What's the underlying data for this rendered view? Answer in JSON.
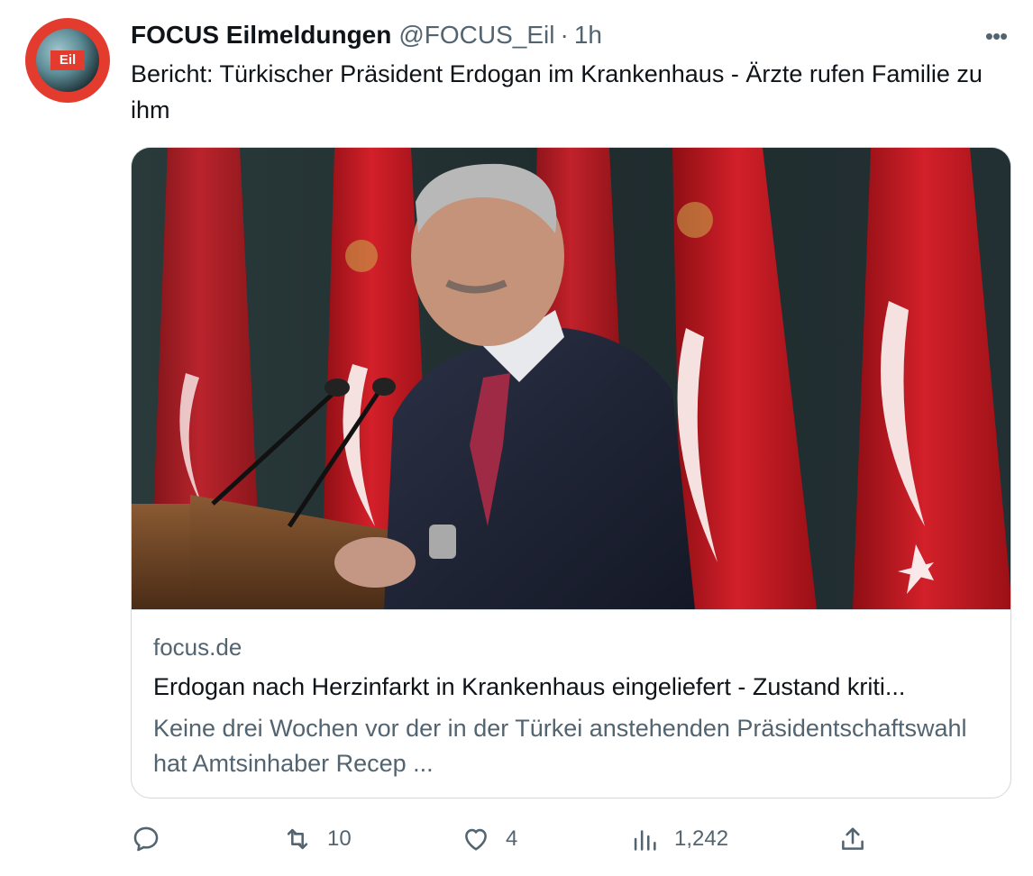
{
  "tweet": {
    "display_name": "FOCUS Eilmeldungen",
    "handle": "@FOCUS_Eil",
    "separator": "·",
    "time": "1h",
    "more_label": "•••",
    "text": "Bericht: Türkischer Präsident Erdogan im Krankenhaus - Ärzte rufen Familie zu ihm",
    "avatar_label": "Eil"
  },
  "card": {
    "domain": "focus.de",
    "title": "Erdogan nach Herzinfarkt in Krankenhaus eingeliefert - Zustand kriti...",
    "description": "Keine drei Wochen vor der in der Türkei anstehenden Präsidentschaftswahl hat Amtsinhaber Recep ..."
  },
  "actions": {
    "reply_count": "",
    "retweet_count": "10",
    "like_count": "4",
    "views_count": "1,242"
  },
  "icons": {
    "reply": "reply-icon",
    "retweet": "retweet-icon",
    "like": "heart-icon",
    "views": "views-icon",
    "share": "share-icon",
    "more": "more-icon"
  },
  "colors": {
    "text": "#0f1419",
    "secondary": "#536471",
    "border": "#cfd9de",
    "avatar_red": "#e33b2e",
    "flag_red": "#c8102e"
  }
}
